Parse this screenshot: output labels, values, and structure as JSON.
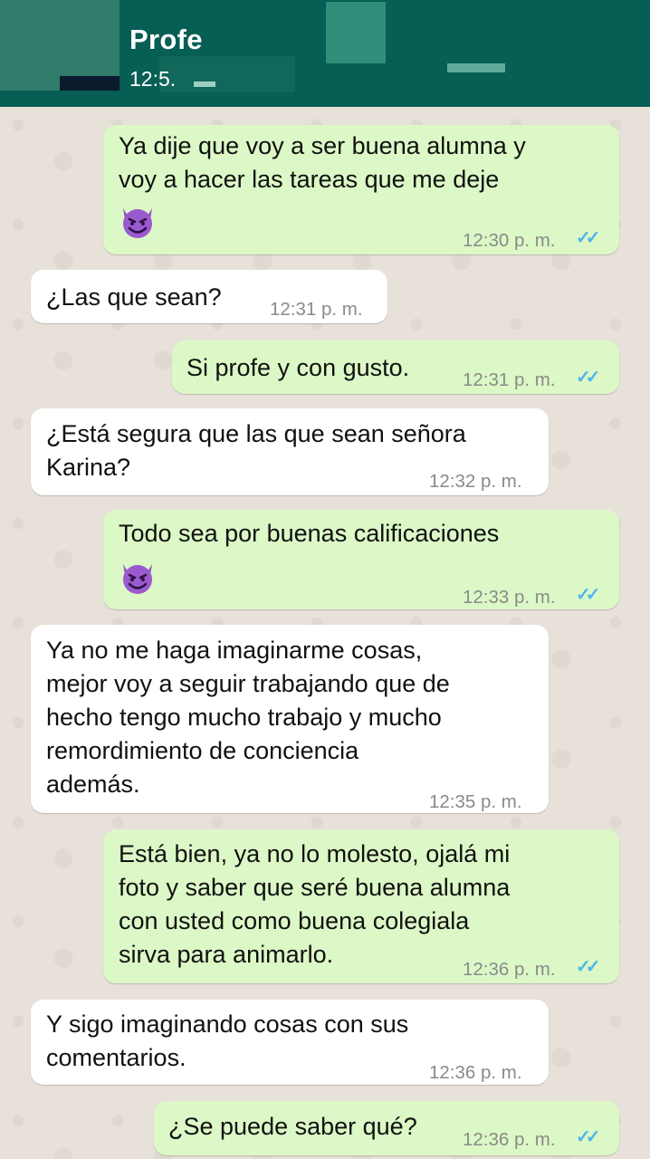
{
  "header": {
    "contact_name": "Profe",
    "last_seen": "12:5."
  },
  "colors": {
    "header_bg": "#075e54",
    "outgoing_bubble": "#dcf8c6",
    "incoming_bubble": "#ffffff",
    "read_ticks": "#4fb6ec"
  },
  "messages": [
    {
      "direction": "out",
      "text": "Ya dije que voy a ser buena alumna y\nvoy a hacer las tareas que me deje",
      "emoji": "smiling-devil",
      "time": "12:30 p. m.",
      "status": "read"
    },
    {
      "direction": "in",
      "text": "¿Las que sean?",
      "time": "12:31 p. m."
    },
    {
      "direction": "out",
      "text": "Si profe y con gusto.",
      "time": "12:31 p. m.",
      "status": "read"
    },
    {
      "direction": "in",
      "text": "¿Está segura que las que sean señora\nKarina?",
      "time": "12:32 p. m."
    },
    {
      "direction": "out",
      "text": "Todo sea por buenas calificaciones",
      "emoji": "smiling-devil",
      "time": "12:33 p. m.",
      "status": "read"
    },
    {
      "direction": "in",
      "text": "Ya no me haga imaginarme cosas,\nmejor voy a seguir trabajando que de\nhecho tengo mucho trabajo y mucho\nremordimiento de conciencia\nademás.",
      "time": "12:35 p. m."
    },
    {
      "direction": "out",
      "text": "Está bien, ya no lo molesto, ojalá mi\nfoto y saber que seré buena alumna\ncon usted como buena colegiala\nsirva para animarlo.",
      "time": "12:36 p. m.",
      "status": "read"
    },
    {
      "direction": "in",
      "text": "Y sigo imaginando cosas con sus\ncomentarios.",
      "time": "12:36 p. m."
    },
    {
      "direction": "out",
      "text": "¿Se puede saber qué?",
      "time": "12:36 p. m.",
      "status": "read"
    }
  ],
  "ticks_glyph": "✓✓"
}
